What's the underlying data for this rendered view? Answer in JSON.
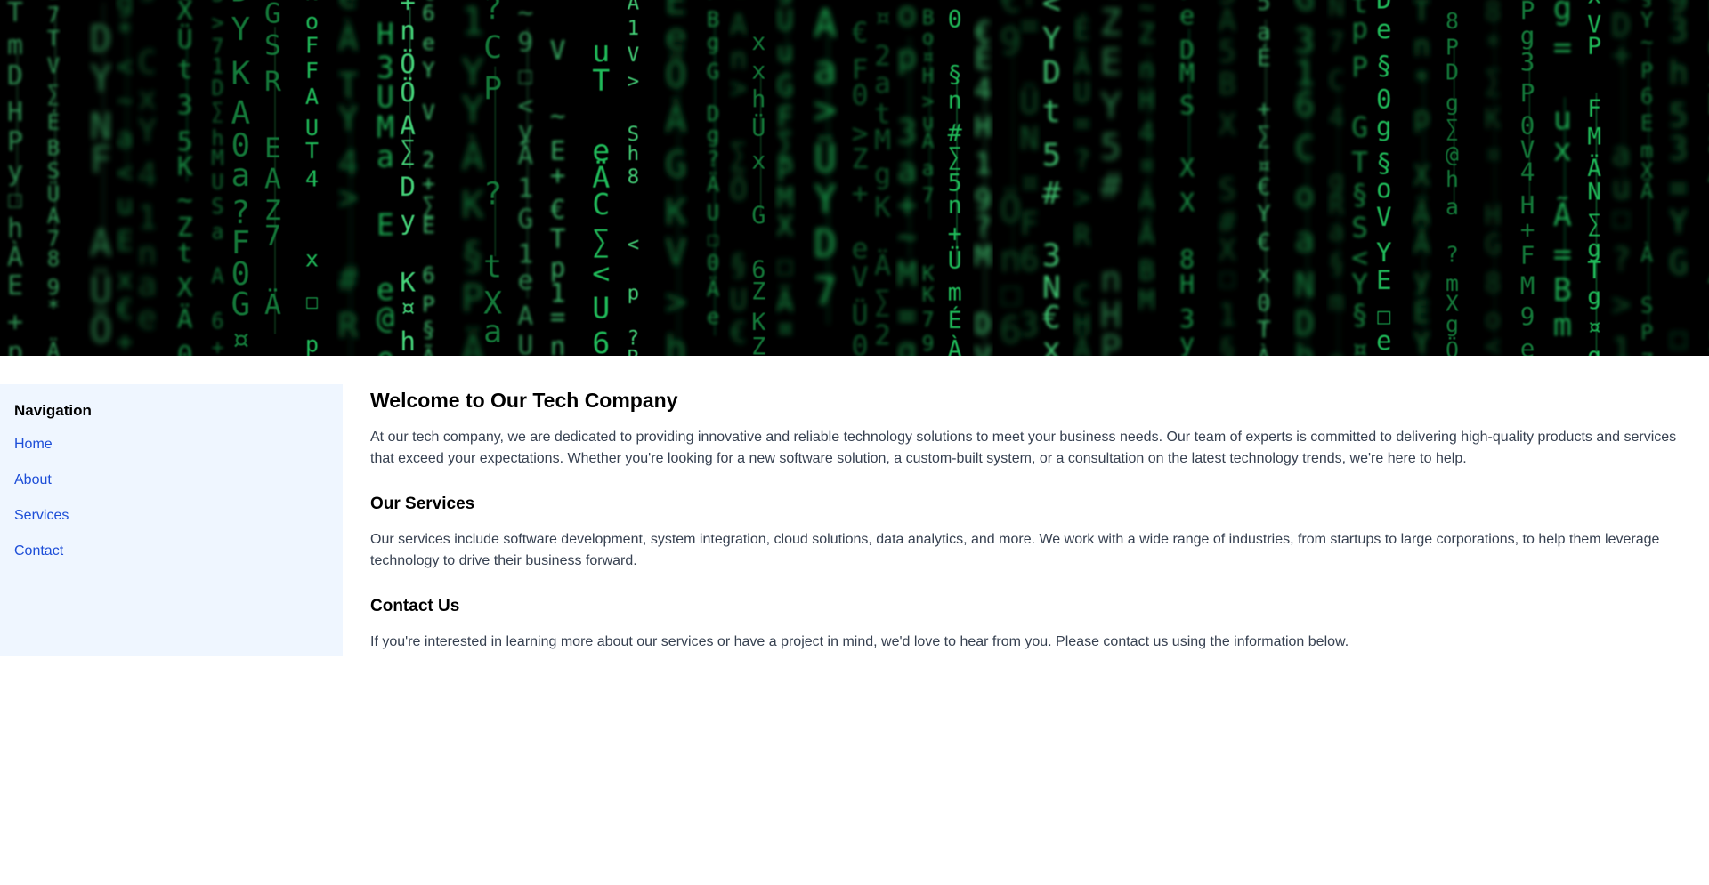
{
  "hero": {
    "image": "matrix-green-code-banner",
    "colors": {
      "bg": "#000000",
      "glyph": "#22c55e",
      "glyph_bright": "#4ade80",
      "glyph_dim": "#15803d"
    }
  },
  "sidebar": {
    "title": "Navigation",
    "items": [
      {
        "label": "Home"
      },
      {
        "label": "About"
      },
      {
        "label": "Services"
      },
      {
        "label": "Contact"
      }
    ]
  },
  "main": {
    "title": "Welcome to Our Tech Company",
    "intro": "At our tech company, we are dedicated to providing innovative and reliable technology solutions to meet your business needs. Our team of experts is committed to delivering high-quality products and services that exceed your expectations. Whether you're looking for a new software solution, a custom-built system, or a consultation on the latest technology trends, we're here to help.",
    "sections": [
      {
        "heading": "Our Services",
        "body": "Our services include software development, system integration, cloud solutions, data analytics, and more. We work with a wide range of industries, from startups to large corporations, to help them leverage technology to drive their business forward."
      },
      {
        "heading": "Contact Us",
        "body": "If you're interested in learning more about our services or have a project in mind, we'd love to hear from you. Please contact us using the information below."
      }
    ]
  }
}
